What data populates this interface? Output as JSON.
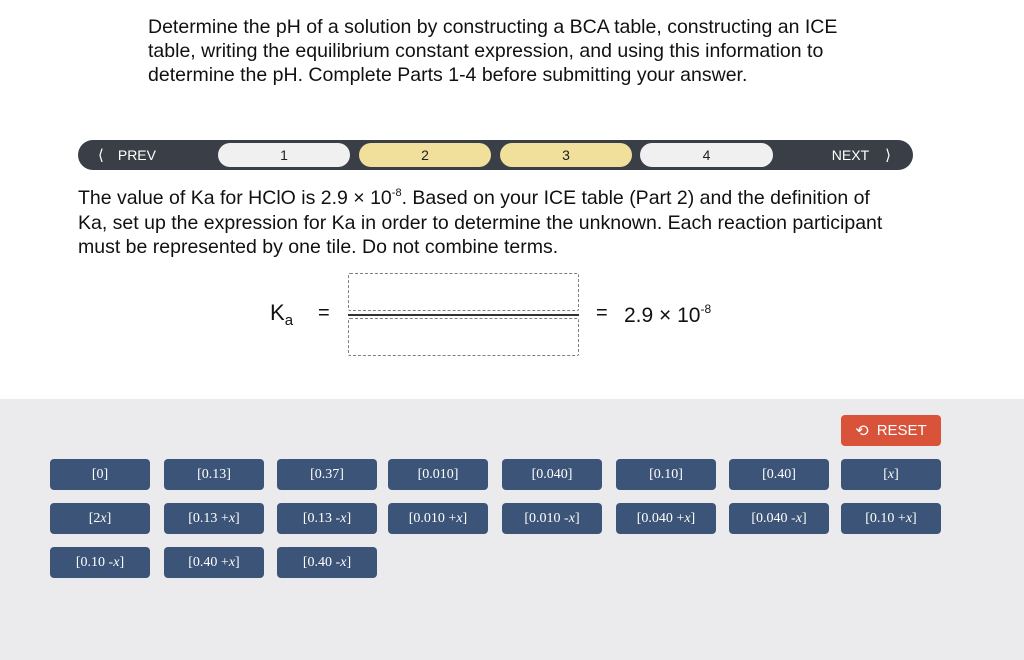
{
  "instructions": "Determine the pH of a solution by constructing a BCA table, constructing an ICE table, writing the equilibrium constant expression, and using this information to determine the pH. Complete Parts 1-4 before submitting your answer.",
  "nav": {
    "prev_label": "PREV",
    "next_label": "NEXT",
    "prev_icon": "chevron-left-icon",
    "next_icon": "chevron-right-icon",
    "steps": [
      {
        "label": "1",
        "state": "plain"
      },
      {
        "label": "2",
        "state": "done"
      },
      {
        "label": "3",
        "state": "done"
      },
      {
        "label": "4",
        "state": "plain"
      }
    ]
  },
  "question": {
    "before_exp": "The value of Ka for HClO is 2.9 × 10",
    "exponent": "-8",
    "after_exp": ". Based on your ICE table (Part 2) and the definition of Ka, set up the expression for Ka in order to determine the unknown. Each reaction participant must be represented by one tile. Do not combine terms."
  },
  "equation": {
    "ka_main": "K",
    "ka_sub": "a",
    "equals": "=",
    "value_mantissa": "2.9 × 10",
    "value_exponent": "-8"
  },
  "reset": {
    "label": "RESET",
    "icon": "undo-icon",
    "color": "#d9533b"
  },
  "tile_color": "#3c5478",
  "tiles": [
    {
      "pre": "[0",
      "var": "",
      "post": "]"
    },
    {
      "pre": "[0.13",
      "var": "",
      "post": "]"
    },
    {
      "pre": "[0.37",
      "var": "",
      "post": "]"
    },
    {
      "pre": "[0.010",
      "var": "",
      "post": "]"
    },
    {
      "pre": "[0.040",
      "var": "",
      "post": "]"
    },
    {
      "pre": "[0.10",
      "var": "",
      "post": "]"
    },
    {
      "pre": "[0.40",
      "var": "",
      "post": "]"
    },
    {
      "pre": "[",
      "var": "x",
      "post": "]"
    },
    {
      "pre": "[2",
      "var": "x",
      "post": "]"
    },
    {
      "pre": "[0.13 + ",
      "var": "x",
      "post": "]"
    },
    {
      "pre": "[0.13 - ",
      "var": "x",
      "post": "]"
    },
    {
      "pre": "[0.010 + ",
      "var": "x",
      "post": "]"
    },
    {
      "pre": "[0.010 - ",
      "var": "x",
      "post": "]"
    },
    {
      "pre": "[0.040 + ",
      "var": "x",
      "post": "]"
    },
    {
      "pre": "[0.040 - ",
      "var": "x",
      "post": "]"
    },
    {
      "pre": "[0.10 + ",
      "var": "x",
      "post": "]"
    },
    {
      "pre": "[0.10 - ",
      "var": "x",
      "post": "]"
    },
    {
      "pre": "[0.40 + ",
      "var": "x",
      "post": "]"
    },
    {
      "pre": "[0.40 - ",
      "var": "x",
      "post": "]"
    }
  ]
}
